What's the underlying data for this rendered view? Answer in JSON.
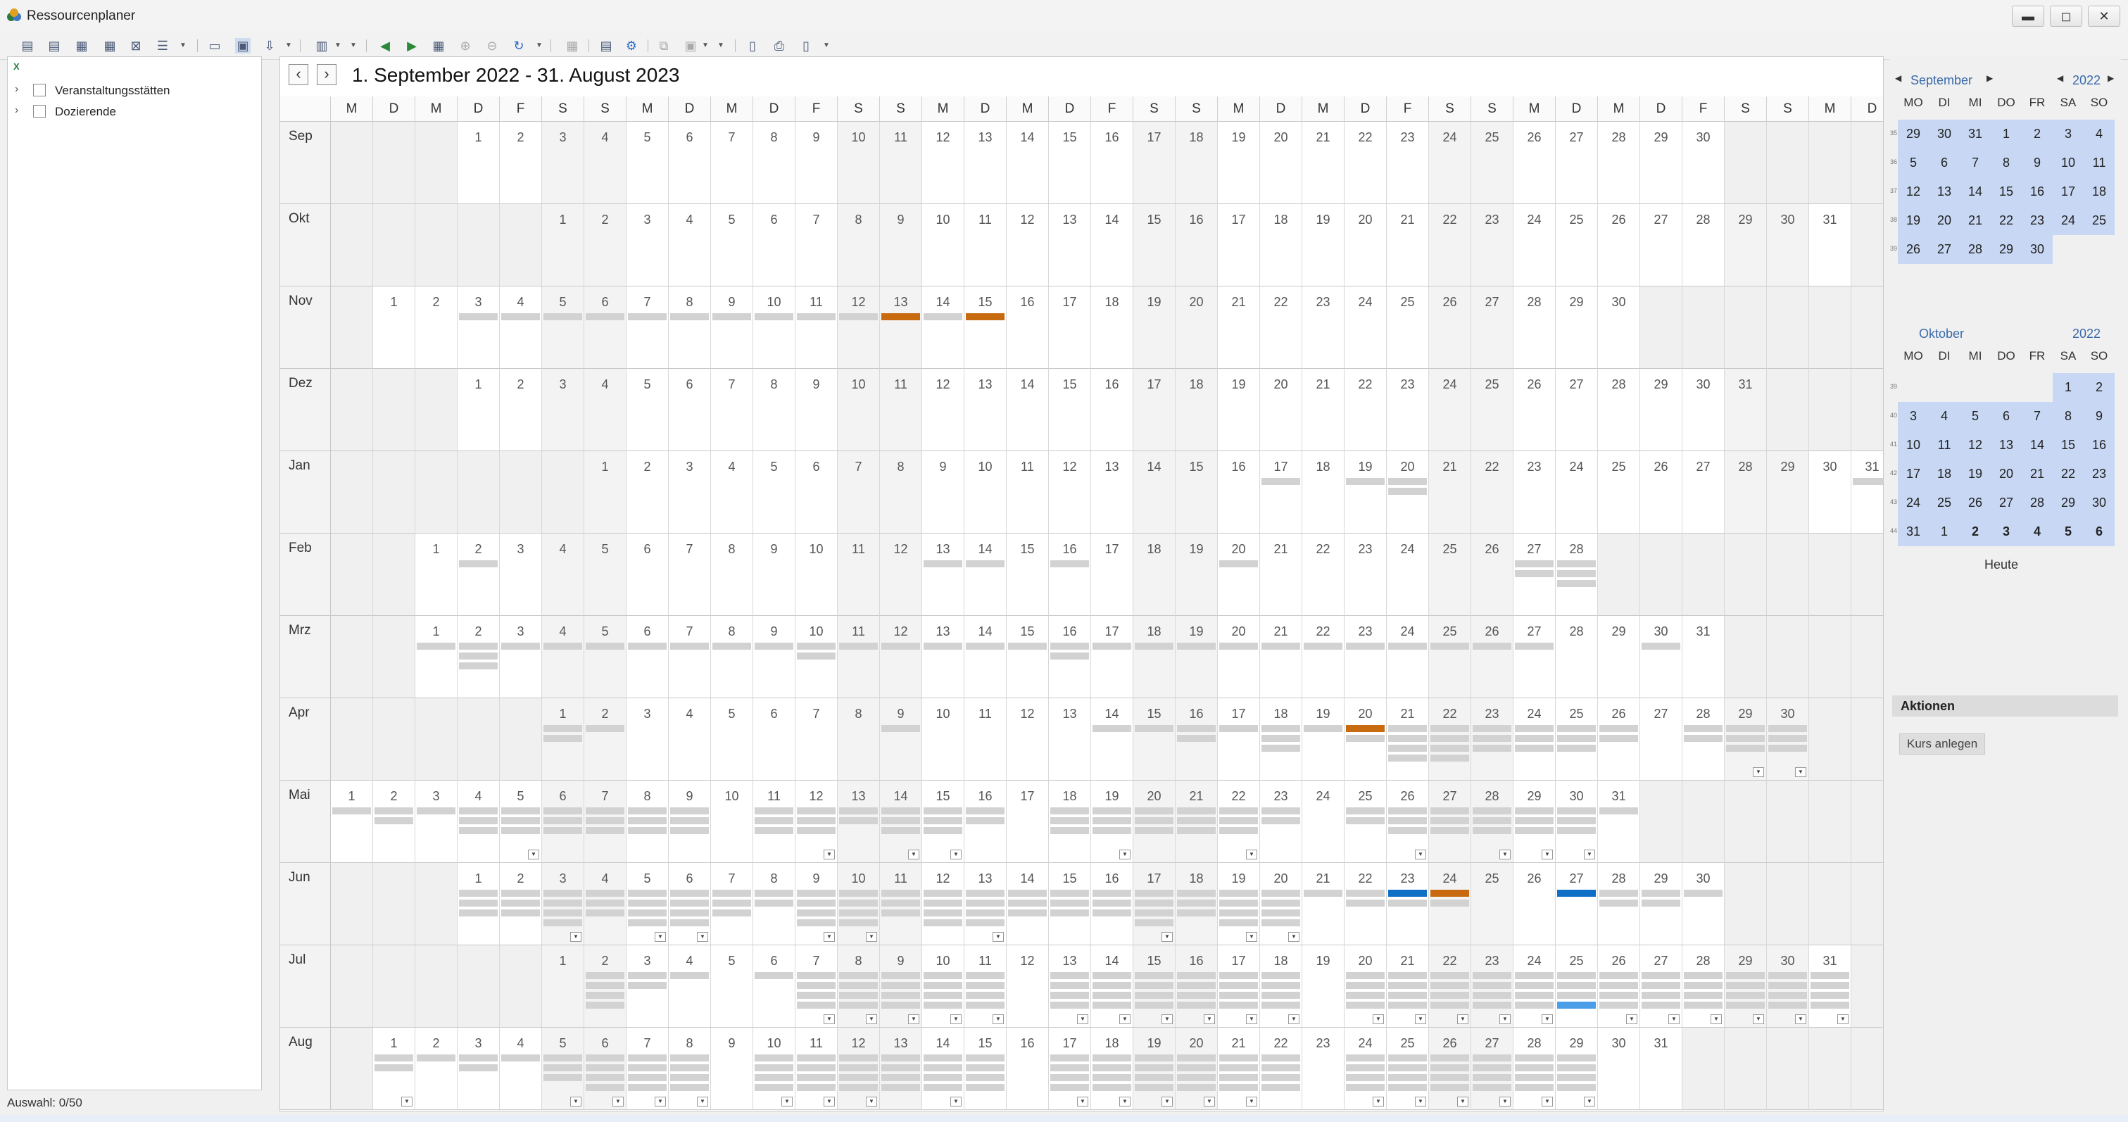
{
  "window": {
    "title": "Ressourcenplaner",
    "minimize": "▬",
    "maximize": "◻",
    "close": "✕"
  },
  "toolbar": {
    "icons": [
      "view-day-icon",
      "view-week-icon",
      "view-month-icon",
      "view-year-icon",
      "view-delete-icon",
      "list-view-icon",
      "grid-view-icon",
      "select-view-icon",
      "assign-icon",
      "layout-icon",
      "back-icon",
      "forward-icon",
      "table-icon",
      "zoom-in-icon",
      "zoom-out-icon",
      "refresh-icon",
      "grid-settings-icon",
      "export-icon",
      "settings-icon",
      "copy-icon",
      "paste-icon",
      "preview-icon",
      "print-icon",
      "print-preview-icon"
    ]
  },
  "tree": {
    "items": [
      {
        "label": "Veranstaltungsstätten"
      },
      {
        "label": "Dozierende"
      }
    ]
  },
  "status": {
    "selection": "Auswahl: 0/50"
  },
  "calendar": {
    "title": "1. September 2022 - 31. August 2023",
    "weekdays": [
      "M",
      "D",
      "M",
      "D",
      "F",
      "S",
      "S",
      "M",
      "D",
      "M",
      "D",
      "F",
      "S",
      "S",
      "M",
      "D",
      "M",
      "D",
      "F",
      "S",
      "S",
      "M",
      "D",
      "M",
      "D",
      "F",
      "S",
      "S",
      "M",
      "D",
      "M",
      "D",
      "F",
      "S",
      "S",
      "M",
      "D"
    ],
    "months": [
      {
        "name": "Sep",
        "offset": 3,
        "days": 30,
        "bars": {}
      },
      {
        "name": "Okt",
        "offset": 5,
        "days": 31,
        "bars": {}
      },
      {
        "name": "Nov",
        "offset": 1,
        "days": 30,
        "bars": {
          "3": 1,
          "4": 1,
          "5": 1,
          "6": 1,
          "7": 1,
          "8": 1,
          "9": 1,
          "10": 1,
          "11": 1,
          "12": 1,
          "13": "o",
          "14": 1,
          "15": "o"
        }
      },
      {
        "name": "Dez",
        "offset": 3,
        "days": 31,
        "bars": {}
      },
      {
        "name": "Jan",
        "offset": 6,
        "days": 31,
        "bars": {
          "17": 1,
          "19": 1,
          "20": 2,
          "31": 1
        }
      },
      {
        "name": "Feb",
        "offset": 2,
        "days": 28,
        "bars": {
          "2": 1,
          "13": 1,
          "14": 1,
          "16": 1,
          "20": 1,
          "27": 2,
          "28": 3
        }
      },
      {
        "name": "Mrz",
        "offset": 2,
        "days": 31,
        "bars": {
          "1": 1,
          "2": 3,
          "3": 1,
          "4": 1,
          "5": 1,
          "6": 1,
          "7": 1,
          "8": 1,
          "9": 1,
          "10": 2,
          "11": 1,
          "12": 1,
          "13": 1,
          "14": 1,
          "15": 1,
          "16": 2,
          "17": 1,
          "18": 1,
          "19": 1,
          "20": 1,
          "21": 1,
          "22": 1,
          "23": 1,
          "24": 1,
          "25": 1,
          "26": 1,
          "27": 1,
          "30": 1
        }
      },
      {
        "name": "Apr",
        "offset": 5,
        "days": 30,
        "bars": {
          "1": 2,
          "2": 1,
          "9": 1,
          "14": 1,
          "15": 1,
          "16": 2,
          "17": 1,
          "18": 3,
          "19": 1,
          "20": "o2",
          "21": 4,
          "22": 4,
          "23": 3,
          "24": 3,
          "25": 3,
          "26": 2,
          "28": 2,
          "29": 3,
          "30": 3
        },
        "more": [
          29,
          30
        ]
      },
      {
        "name": "Mai",
        "offset": 0,
        "days": 31,
        "bars": {
          "1": 1,
          "2": 2,
          "3": 1,
          "4": 3,
          "5": 3,
          "6": 3,
          "7": 3,
          "8": 3,
          "9": 3,
          "11": 3,
          "12": 3,
          "13": 2,
          "14": 3,
          "15": 3,
          "16": 2,
          "18": 3,
          "19": 3,
          "20": 3,
          "21": 3,
          "22": 3,
          "23": 2,
          "25": 2,
          "26": 3,
          "27": 3,
          "28": 3,
          "29": 3,
          "30": 3,
          "31": 1
        },
        "more": [
          5,
          12,
          14,
          15,
          19,
          22,
          26,
          28,
          29,
          30
        ]
      },
      {
        "name": "Jun",
        "offset": 3,
        "days": 30,
        "bars": {
          "1": 3,
          "2": 3,
          "3": 4,
          "4": 3,
          "5": 4,
          "6": 4,
          "7": 3,
          "8": 2,
          "9": 4,
          "10": 4,
          "11": 3,
          "12": 4,
          "13": 4,
          "14": 3,
          "15": 3,
          "16": 3,
          "17": 4,
          "18": 3,
          "19": 4,
          "20": 4,
          "21": 1,
          "22": 2,
          "23": "b2",
          "24": "o2",
          "27": "b",
          "28": 2,
          "29": 2,
          "30": 1
        },
        "more": [
          3,
          5,
          6,
          9,
          10,
          13,
          17,
          19,
          20
        ]
      },
      {
        "name": "Jul",
        "offset": 5,
        "days": 31,
        "bars": {
          "2": 4,
          "3": 2,
          "4": 1,
          "6": 1,
          "7": 4,
          "8": 4,
          "9": 4,
          "10": 4,
          "11": 4,
          "13": 4,
          "14": 4,
          "15": 4,
          "16": 4,
          "17": 4,
          "18": 4,
          "20": 4,
          "21": 4,
          "22": 4,
          "23": 4,
          "24": 4,
          "25": "lb",
          "26": 4,
          "27": 4,
          "28": 4,
          "29": 4,
          "30": 4,
          "31": 4
        },
        "more": [
          7,
          8,
          9,
          10,
          11,
          13,
          14,
          15,
          16,
          17,
          18,
          20,
          21,
          22,
          23,
          24,
          26,
          27,
          28,
          29,
          30,
          31
        ]
      },
      {
        "name": "Aug",
        "offset": 1,
        "days": 31,
        "bars": {
          "1": 2,
          "2": 1,
          "3": 2,
          "4": 1,
          "5": 3,
          "6": 4,
          "7": 4,
          "8": 4,
          "10": 4,
          "11": 4,
          "12": 4,
          "13": 4,
          "14": 4,
          "15": 4,
          "17": 4,
          "18": 4,
          "19": 4,
          "20": 4,
          "21": 4,
          "22": 4,
          "24": 4,
          "25": 4,
          "26": 4,
          "27": 4,
          "28": 4,
          "29": 4
        },
        "more": [
          1,
          5,
          6,
          7,
          8,
          10,
          11,
          12,
          14,
          17,
          18,
          19,
          20,
          21,
          24,
          25,
          26,
          27,
          28,
          29
        ]
      }
    ]
  },
  "mini_calendars": {
    "dow": [
      "MO",
      "DI",
      "MI",
      "DO",
      "FR",
      "SA",
      "SO"
    ],
    "cal1": {
      "month": "September",
      "year": "2022",
      "weeks": [
        "35",
        "36",
        "37",
        "38",
        "39"
      ],
      "rows": [
        [
          "29",
          "30",
          "31",
          "1",
          "2",
          "3",
          "4"
        ],
        [
          "5",
          "6",
          "7",
          "8",
          "9",
          "10",
          "11"
        ],
        [
          "12",
          "13",
          "14",
          "15",
          "16",
          "17",
          "18"
        ],
        [
          "19",
          "20",
          "21",
          "22",
          "23",
          "24",
          "25"
        ],
        [
          "26",
          "27",
          "28",
          "29",
          "30",
          "",
          ""
        ]
      ]
    },
    "cal2": {
      "month": "Oktober",
      "year": "2022",
      "weeks": [
        "39",
        "40",
        "41",
        "42",
        "43",
        "44"
      ],
      "rows": [
        [
          "",
          "",
          "",
          "",
          "",
          "1",
          "2"
        ],
        [
          "3",
          "4",
          "5",
          "6",
          "7",
          "8",
          "9"
        ],
        [
          "10",
          "11",
          "12",
          "13",
          "14",
          "15",
          "16"
        ],
        [
          "17",
          "18",
          "19",
          "20",
          "21",
          "22",
          "23"
        ],
        [
          "24",
          "25",
          "26",
          "27",
          "28",
          "29",
          "30"
        ],
        [
          "31",
          "1",
          "2",
          "3",
          "4",
          "5",
          "6"
        ]
      ]
    },
    "today": "Heute"
  },
  "actions": {
    "header": "Aktionen",
    "create_course": "Kurs anlegen"
  },
  "colors": {
    "accent": "#c86a10",
    "selection": "#c8d8f4",
    "blue": "#0f6fc6"
  }
}
